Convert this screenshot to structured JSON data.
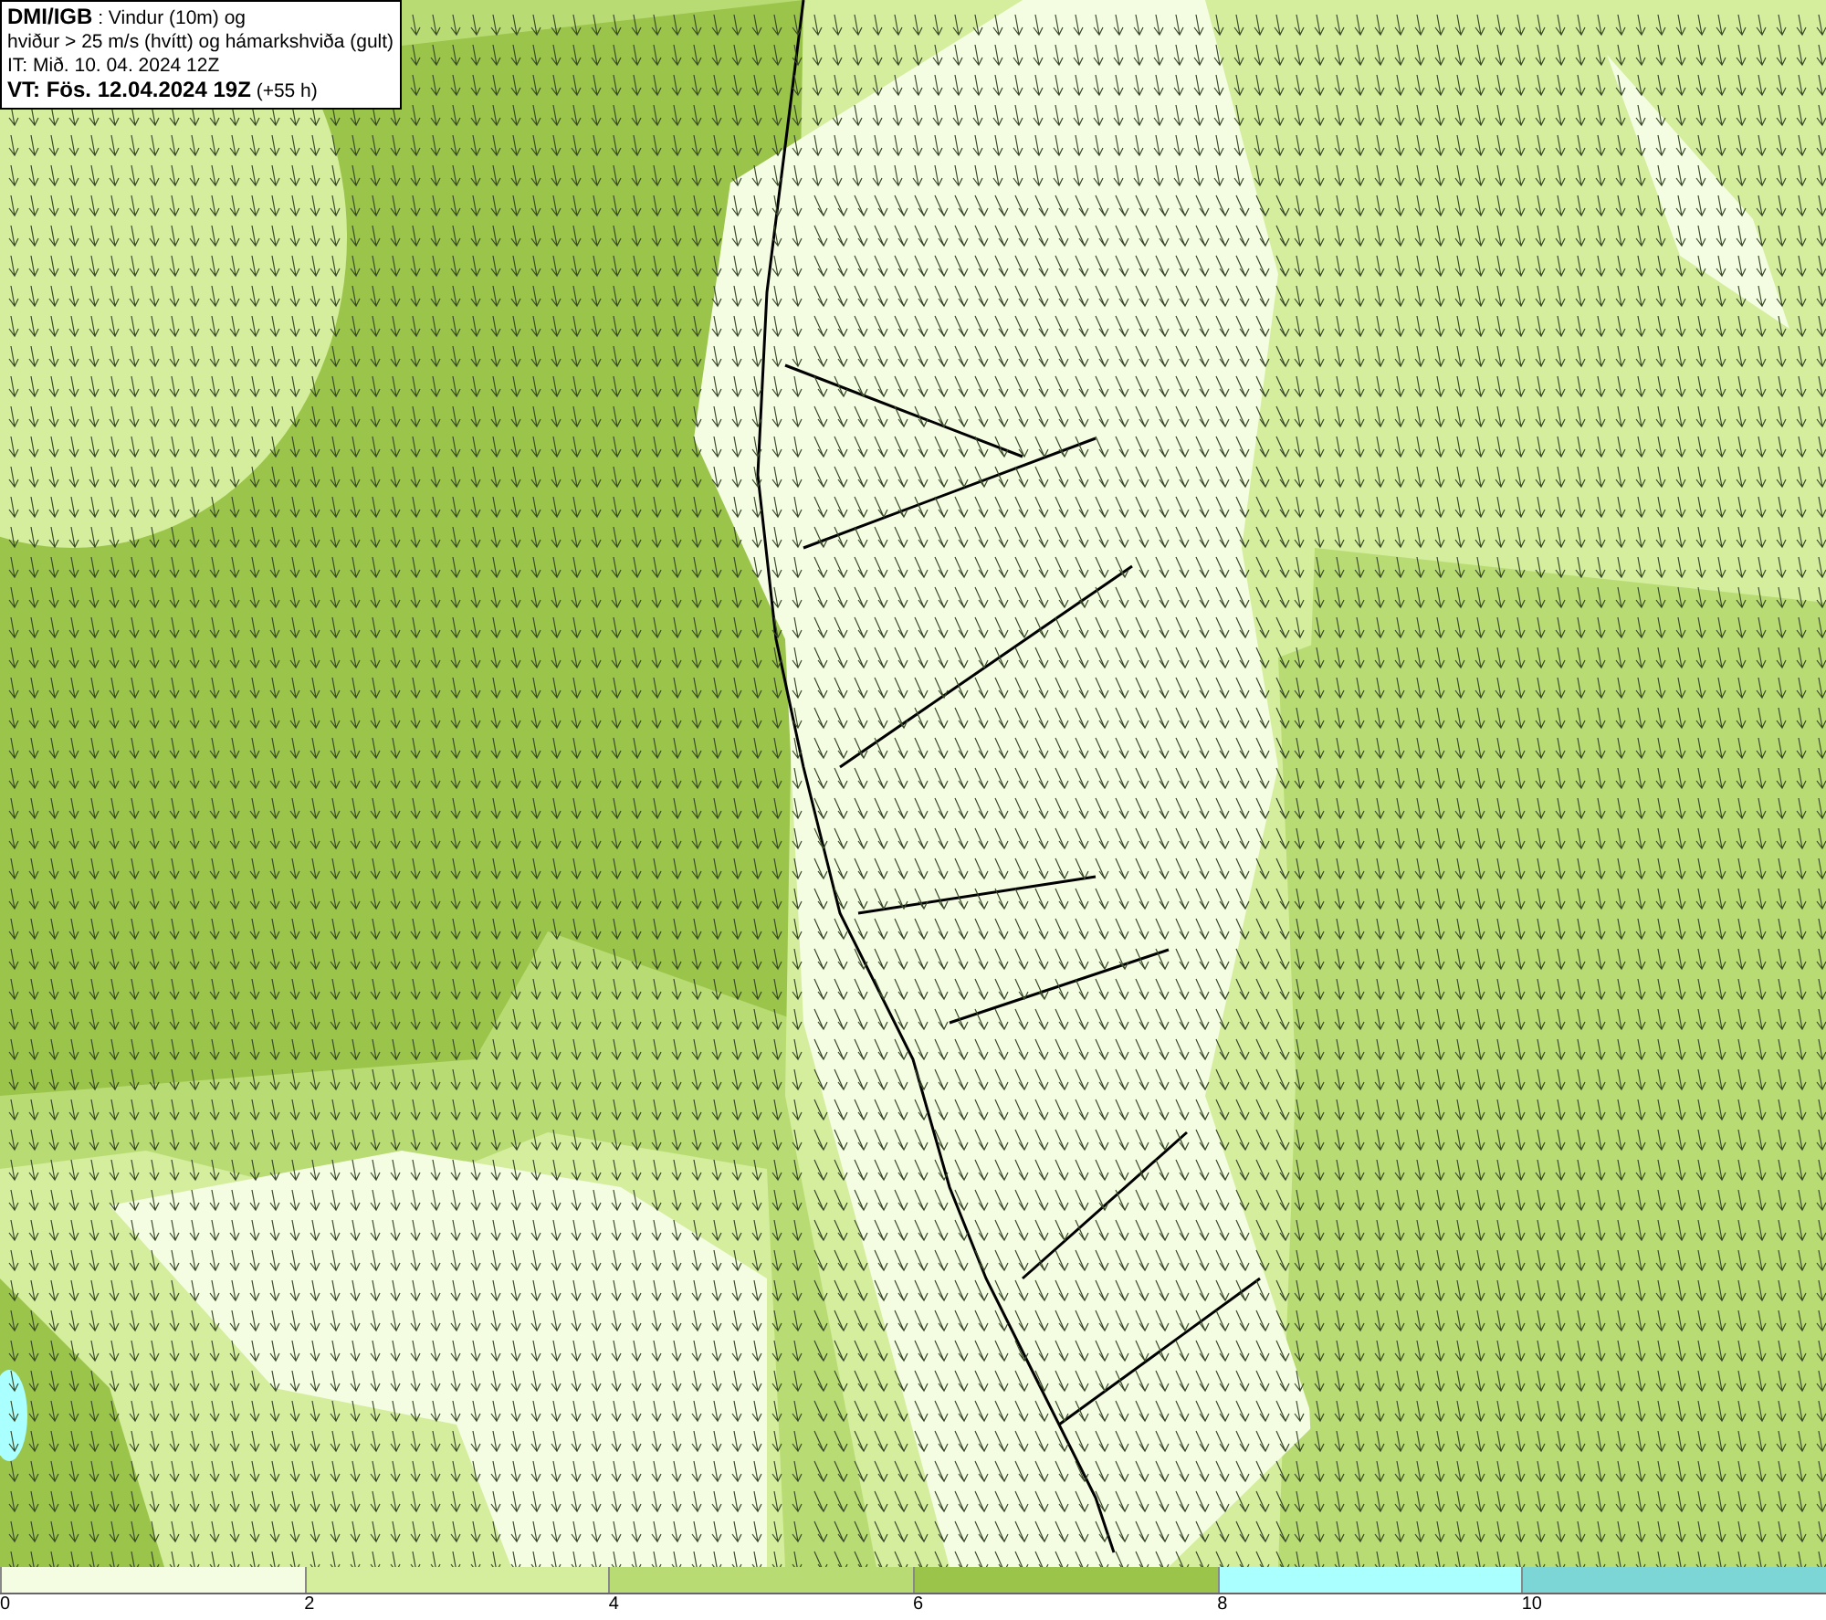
{
  "header": {
    "lines": [
      "**DMI/IGB** : Vindur (10m) og",
      "hviður > 25 m/s (hvítt) og hámarkshviða (gult)",
      "IT: Mið. 10. 04. 2024 12Z",
      "**VT: Fös. 12.04.2024 19Z** (+55 h)"
    ]
  },
  "color_scale": {
    "bins": [
      {
        "color": "#f4fce2"
      },
      {
        "color": "#d4ee9e"
      },
      {
        "color": "#b8dc73"
      },
      {
        "color": "#9bc44a"
      },
      {
        "color": "#aaffff"
      },
      {
        "color": "#7dd6d6"
      }
    ],
    "ticks": [
      "0",
      "2",
      "4",
      "6",
      "8",
      "10"
    ]
  }
}
